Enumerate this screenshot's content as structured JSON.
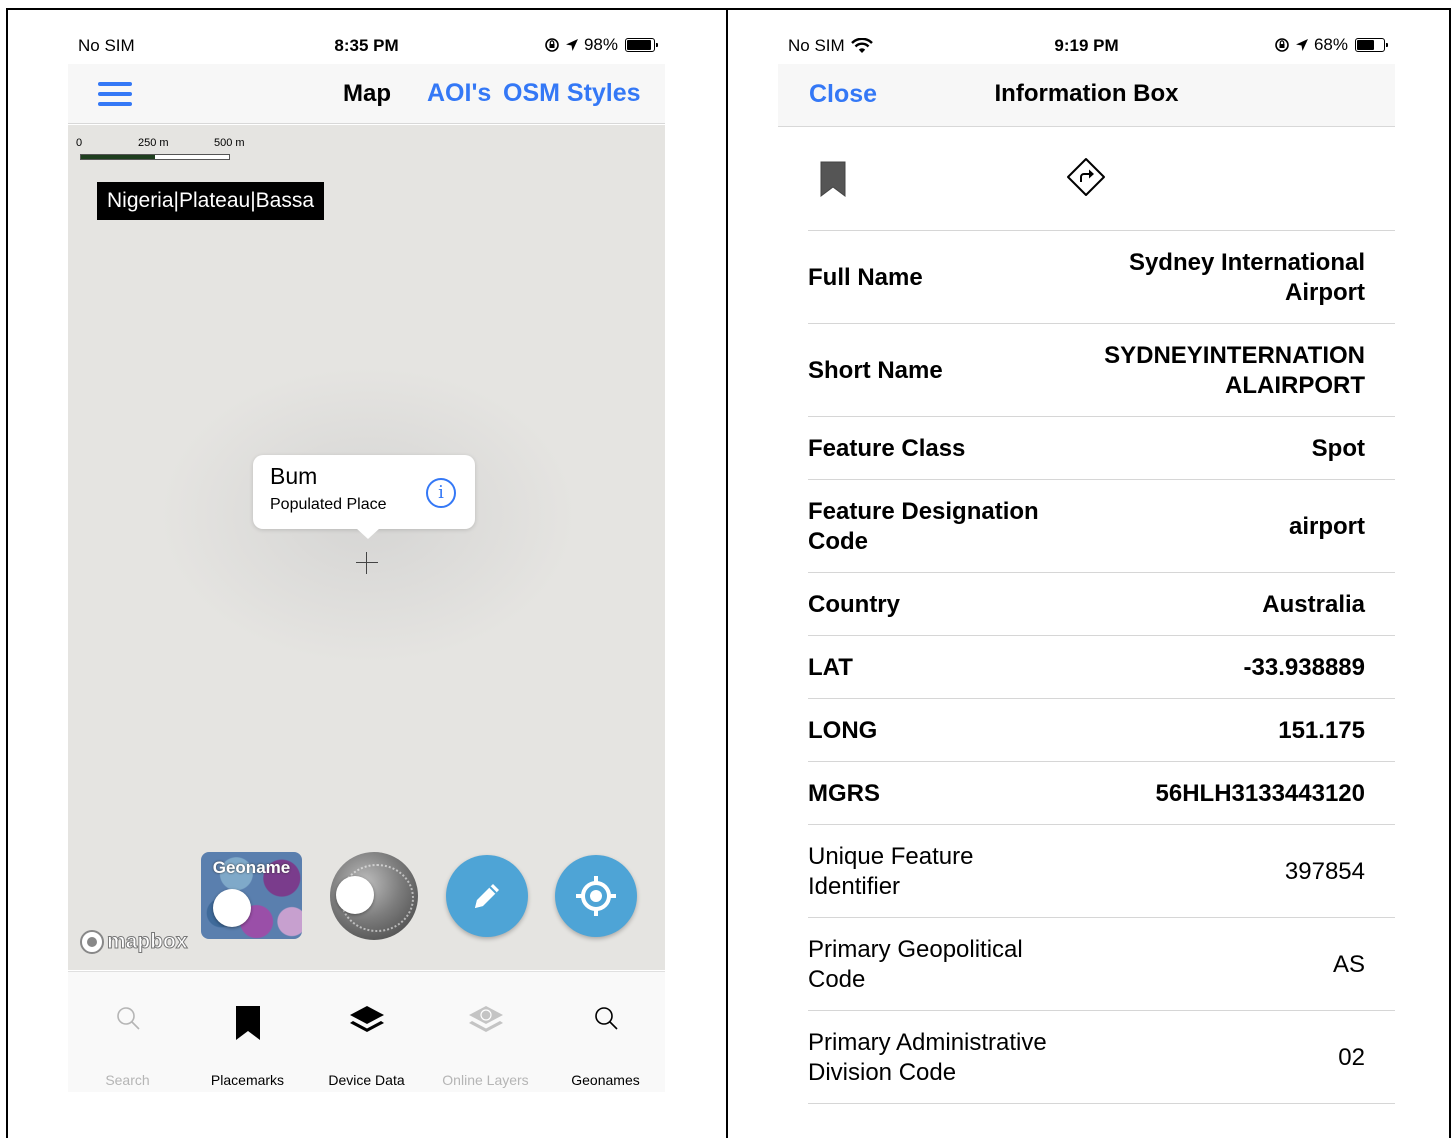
{
  "left": {
    "status_bar": {
      "carrier": "No SIM",
      "time": "8:35 PM",
      "battery": "98%"
    },
    "nav": {
      "title": "Map",
      "aoi_link": "AOI's",
      "osm_link": "OSM Styles"
    },
    "map": {
      "scale": {
        "zero": "0",
        "mid": "250 m",
        "end": "500 m"
      },
      "aoi_label": "Nigeria|Plateau|Bassa",
      "callout": {
        "title": "Bum",
        "subtitle": "Populated Place"
      },
      "geoname_toggle_label": "Geoname",
      "attribution": "mapbox"
    },
    "tabs": [
      {
        "label": "Search",
        "icon": "search-icon",
        "enabled": false
      },
      {
        "label": "Placemarks",
        "icon": "bookmark-icon",
        "enabled": true
      },
      {
        "label": "Device Data",
        "icon": "layers-icon",
        "enabled": true
      },
      {
        "label": "Online Layers",
        "icon": "online-layers-icon",
        "enabled": false
      },
      {
        "label": "Geonames",
        "icon": "search-icon",
        "enabled": true
      }
    ],
    "colors": {
      "accent": "#3478f6",
      "fab": "#4ea4d6",
      "map_bg": "#e5e4e1"
    }
  },
  "right": {
    "status_bar": {
      "carrier": "No SIM",
      "time": "9:19 PM",
      "battery": "68%"
    },
    "nav": {
      "close": "Close",
      "title": "Information Box"
    },
    "rows": [
      {
        "key_lines": [
          "Full Name"
        ],
        "value_lines": [
          "Sydney International",
          "Airport"
        ],
        "bold": true
      },
      {
        "key_lines": [
          "Short Name"
        ],
        "value_lines": [
          "SYDNEYINTERNATION",
          "ALAIRPORT"
        ],
        "bold": true
      },
      {
        "key_lines": [
          "Feature Class"
        ],
        "value_lines": [
          "Spot"
        ],
        "bold": true
      },
      {
        "key_lines": [
          "Feature Designation",
          "Code"
        ],
        "value_lines": [
          "airport"
        ],
        "bold": true
      },
      {
        "key_lines": [
          "Country"
        ],
        "value_lines": [
          "Australia"
        ],
        "bold": true
      },
      {
        "key_lines": [
          "LAT"
        ],
        "value_lines": [
          "-33.938889"
        ],
        "bold": true
      },
      {
        "key_lines": [
          "LONG"
        ],
        "value_lines": [
          "151.175"
        ],
        "bold": true
      },
      {
        "key_lines": [
          "MGRS"
        ],
        "value_lines": [
          "56HLH3133443120"
        ],
        "bold": true
      },
      {
        "key_lines": [
          "Unique Feature",
          "Identifier"
        ],
        "value_lines": [
          "397854"
        ],
        "bold": false
      },
      {
        "key_lines": [
          "Primary Geopolitical",
          "Code"
        ],
        "value_lines": [
          "AS"
        ],
        "bold": false
      },
      {
        "key_lines": [
          "Primary Administrative",
          "Division Code"
        ],
        "value_lines": [
          "02"
        ],
        "bold": false
      }
    ]
  }
}
